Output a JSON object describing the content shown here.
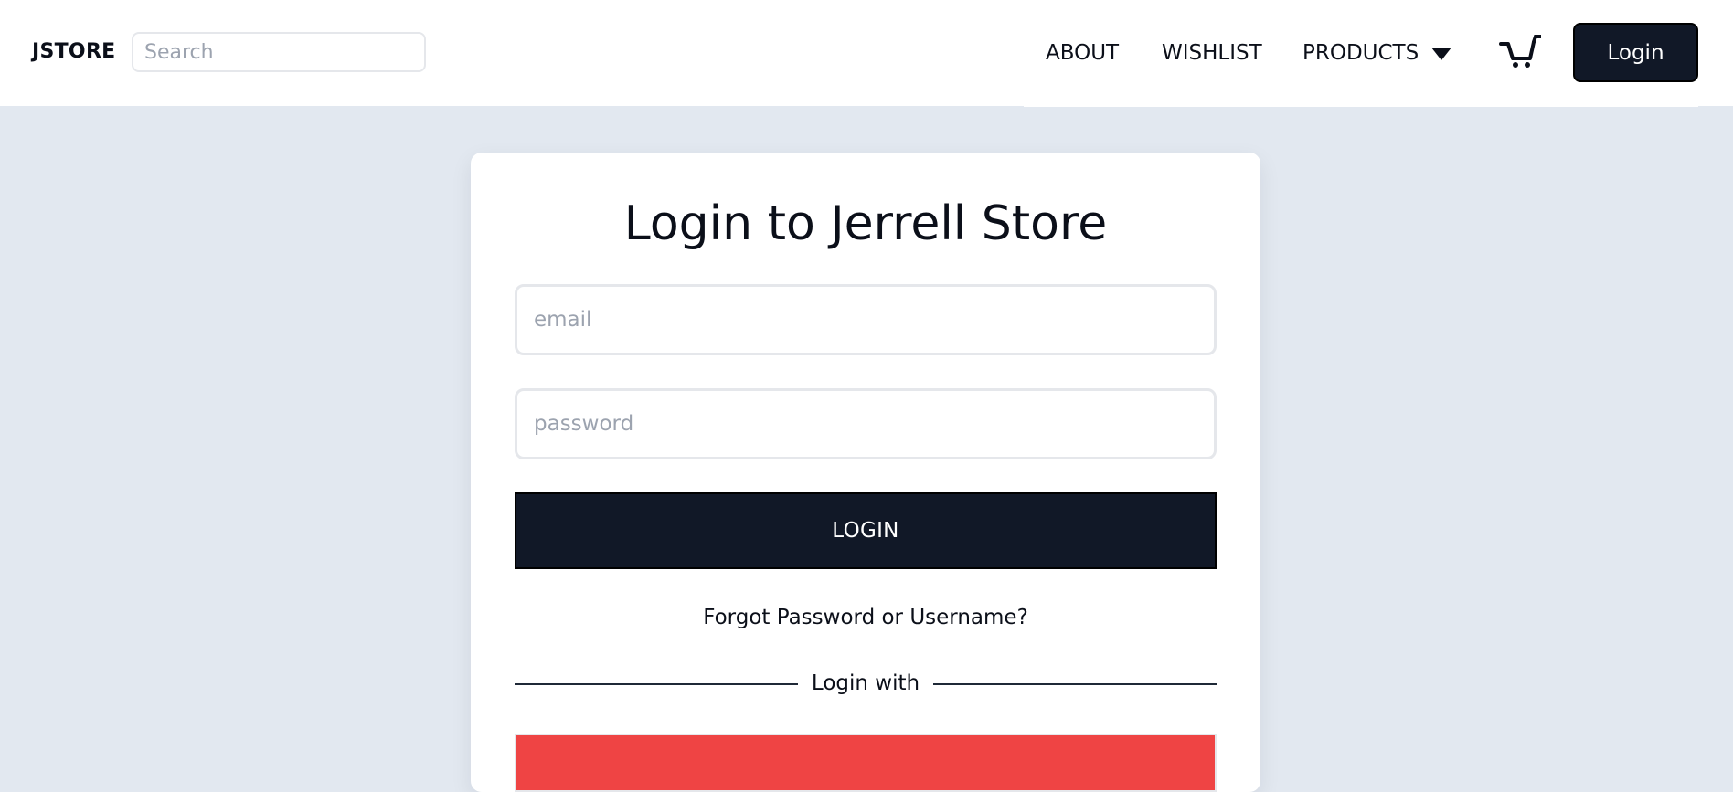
{
  "navbar": {
    "logo": "JSTORE",
    "search": {
      "placeholder": "Search",
      "value": ""
    },
    "links": [
      {
        "label": "ABOUT"
      },
      {
        "label": "WISHLIST"
      },
      {
        "label": "PRODUCTS"
      }
    ],
    "cart_icon": "cart-icon",
    "login_label": "Login"
  },
  "login_card": {
    "title": "Login to Jerrell Store",
    "email": {
      "placeholder": "email",
      "value": ""
    },
    "password": {
      "placeholder": "password",
      "value": ""
    },
    "login_button": "LOGIN",
    "forgot_link": "Forgot Password or Username?",
    "divider_text": "Login with"
  },
  "colors": {
    "background": "#e2e8f0",
    "primary_dark": "#111827",
    "social_red": "#ef4444"
  }
}
